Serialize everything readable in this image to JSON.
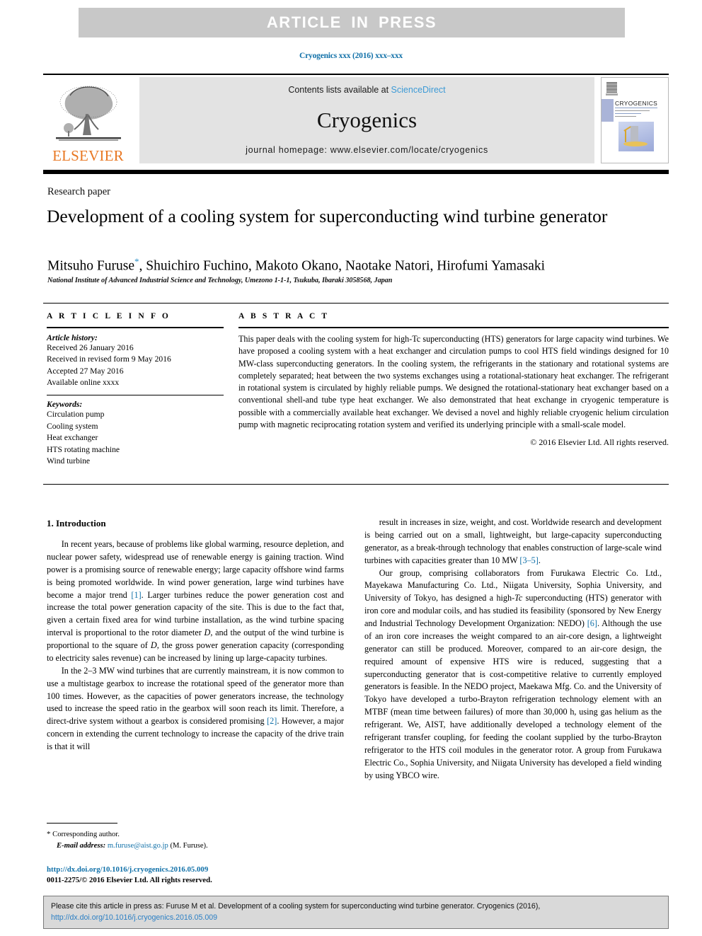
{
  "banner": {
    "text": "ARTICLE  IN  PRESS"
  },
  "journal_ref": "Cryogenics xxx (2016) xxx–xxx",
  "masthead": {
    "publisher": "ELSEVIER",
    "contents_prefix": "Contents lists available at ",
    "contents_link": "ScienceDirect",
    "journal_title": "Cryogenics",
    "homepage": "journal homepage: www.elsevier.com/locate/cryogenics",
    "cover_title": "CRYOGENICS"
  },
  "article": {
    "section_type": "Research paper",
    "title": "Development of a cooling system for superconducting wind turbine generator",
    "authors": "Mitsuho Furuse",
    "authors_rest": ", Shuichiro Fuchino, Makoto Okano, Naotake Natori, Hirofumi Yamasaki",
    "corresponding_marker": "*",
    "affiliation": "National Institute of Advanced Industrial Science and Technology, Umezono 1-1-1, Tsukuba, Ibaraki 3058568, Japan"
  },
  "info": {
    "heading": "A R T I C L E    I N F O",
    "history_label": "Article history:",
    "history": [
      "Received 26 January 2016",
      "Received in revised form 9 May 2016",
      "Accepted 27 May 2016",
      "Available online xxxx"
    ],
    "keywords_label": "Keywords:",
    "keywords": [
      "Circulation pump",
      "Cooling system",
      "Heat exchanger",
      "HTS rotating machine",
      "Wind turbine"
    ]
  },
  "abstract": {
    "heading": "A B S T R A C T",
    "body": "This paper deals with the cooling system for high-Tc superconducting (HTS) generators for large capacity wind turbines. We have proposed a cooling system with a heat exchanger and circulation pumps to cool HTS field windings designed for 10 MW-class superconducting generators. In the cooling system, the refrigerants in the stationary and rotational systems are completely separated; heat between the two systems exchanges using a rotational-stationary heat exchanger. The refrigerant in rotational system is circulated by highly reliable pumps. We designed the rotational-stationary heat exchanger based on a conventional shell-and tube type heat exchanger. We also demonstrated that heat exchange in cryogenic temperature is possible with a commercially available heat exchanger. We devised a novel and highly reliable cryogenic helium circulation pump with magnetic reciprocating rotation system and verified its underlying principle with a small-scale model.",
    "copyright": "© 2016 Elsevier Ltd. All rights reserved."
  },
  "body": {
    "section_number_title": "1. Introduction",
    "left_p1_a": "In recent years, because of problems like global warming, resource depletion, and nuclear power safety, widespread use of renewable energy is gaining traction. Wind power is a promising source of renewable energy; large capacity offshore wind farms is being promoted worldwide. In wind power generation, large wind turbines have become a major trend ",
    "left_p1_ref": "[1]",
    "left_p1_b": ". Larger turbines reduce the power generation cost and increase the total power generation capacity of the site. This is due to the fact that, given a certain fixed area for wind turbine installation, as the wind turbine spacing interval is proportional to the rotor diameter ",
    "left_p1_italic1": "D",
    "left_p1_c": ", and the output of the wind turbine is proportional to the square of ",
    "left_p1_italic2": "D",
    "left_p1_d": ", the gross power generation capacity (corresponding to electricity sales revenue) can be increased by lining up large-capacity turbines.",
    "left_p2_a": "In the 2–3 MW wind turbines that are currently mainstream, it is now common to use a multistage gearbox to increase the rotational speed of the generator more than 100 times. However, as the capacities of power generators increase, the technology used to increase the speed ratio in the gearbox will soon reach its limit. Therefore, a direct-drive system without a gearbox is considered promising ",
    "left_p2_ref": "[2]",
    "left_p2_b": ". However, a major concern in extending the current technology to increase the capacity of the drive train is that it will",
    "right_p1_a": "result in increases in size, weight, and cost. Worldwide research and development is being carried out on a small, lightweight, but large-capacity superconducting generator, as a break-through technology that enables construction of large-scale wind turbines with capacities greater than 10 MW ",
    "right_p1_ref": "[3–5]",
    "right_p1_b": ".",
    "right_p2_a": "Our group, comprising collaborators from Furukawa Electric Co. Ltd., Mayekawa Manufacturing Co. Ltd., Niigata University, Sophia University, and University of Tokyo, has designed a high-",
    "right_p2_sub": "Tc",
    "right_p2_b": " superconducting (HTS) generator with iron core and modular coils, and has studied its feasibility (sponsored by New Energy and Industrial Technology Development Organization: NEDO) ",
    "right_p2_ref": "[6]",
    "right_p2_c": ". Although the use of an iron core increases the weight compared to an air-core design, a lightweight generator can still be produced. Moreover, compared to an air-core design, the required amount of expensive HTS wire is reduced, suggesting that a superconducting generator that is cost-competitive relative to currently employed generators is feasible. In the NEDO project, Maekawa Mfg. Co. and the University of Tokyo have developed a turbo-Brayton refrigeration technology element with an MTBF (mean time between failures) of more than 30,000 h, using gas helium as the refrigerant. We, AIST, have additionally developed a technology element of the refrigerant transfer coupling, for feeding the coolant supplied by the turbo-Brayton refrigerator to the HTS coil modules in the generator rotor. A group from Furukawa Electric Co., Sophia University, and Niigata University has developed a field winding by using YBCO wire."
  },
  "footnote": {
    "star": "*",
    "corresponding": "Corresponding author.",
    "email_label": "E-mail address:",
    "email": "m.furuse@aist.go.jp",
    "email_suffix": "(M. Furuse)."
  },
  "doi_block": {
    "doi_url": "http://dx.doi.org/10.1016/j.cryogenics.2016.05.009",
    "issn_line": "0011-2275/© 2016 Elsevier Ltd. All rights reserved."
  },
  "citation": {
    "text": "Please cite this article in press as: Furuse M et al. Development of a cooling system for superconducting wind turbine generator. Cryogenics (2016), ",
    "link1": "http://",
    "link2": "dx.doi.org/10.1016/j.cryogenics.2016.05.009"
  }
}
